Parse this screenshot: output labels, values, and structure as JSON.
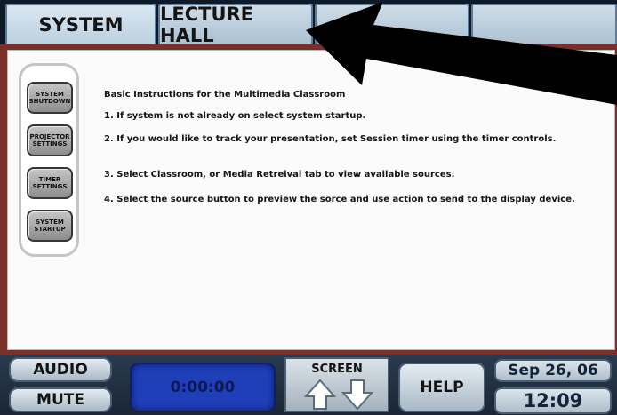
{
  "tabs": [
    {
      "label": "SYSTEM"
    },
    {
      "label": "LECTURE HALL"
    },
    {
      "label": ""
    },
    {
      "label": ""
    }
  ],
  "sidebar": {
    "buttons": [
      {
        "line1": "SYSTEM",
        "line2": "SHUTDOWN"
      },
      {
        "line1": "PROJECTOR",
        "line2": "SETTINGS"
      },
      {
        "line1": "TIMER",
        "line2": "SETTINGS"
      },
      {
        "line1": "SYSTEM",
        "line2": "STARTUP"
      }
    ]
  },
  "instructions": {
    "title": "Basic Instructions for the Multimedia Classroom",
    "steps": [
      "1. If system is not already on select system startup.",
      "2. If you would like to track your presentation, set Session timer using the timer controls.",
      "3. Select Classroom, or Media Retreival tab to view available sources.",
      "4. Select the source button to preview the sorce and use action to send to the display device."
    ]
  },
  "bottom": {
    "audio_label": "AUDIO",
    "mute_label": "MUTE",
    "timer_value": "0:00:00",
    "screen_label": "SCREEN",
    "help_label": "HELP",
    "date": "Sep 26, 06",
    "time": "12:09"
  },
  "icons": {
    "screen_up": "arrow-up-icon",
    "screen_down": "arrow-down-icon",
    "overlay": "pointer-arrow-icon"
  },
  "colors": {
    "panel_border": "#7a2f28",
    "timer_blue": "#1f3fb8",
    "tab_bg": "#cfdde8"
  }
}
